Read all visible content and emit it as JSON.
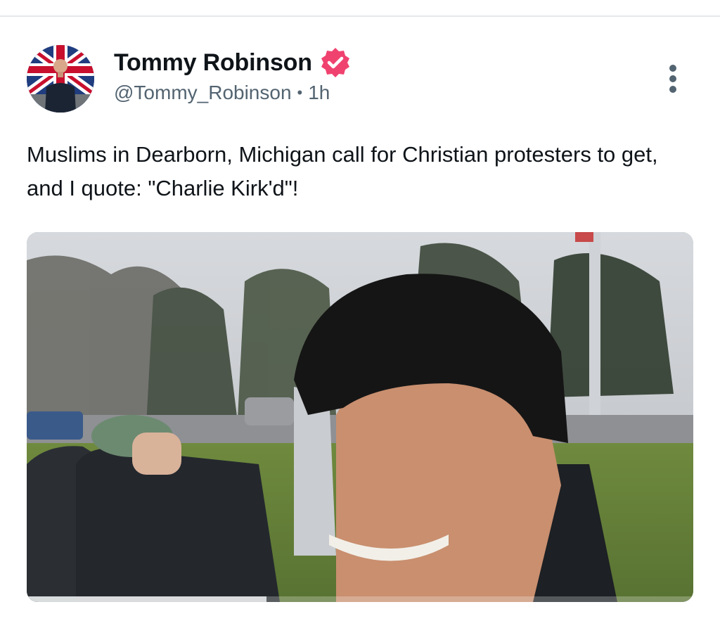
{
  "post": {
    "author": {
      "display_name": "Tommy Robinson",
      "handle": "@Tommy_Robinson",
      "verified": true,
      "verified_color": "#f0426f"
    },
    "separator": "•",
    "time": "1h",
    "text": "Muslims in Dearborn, Michigan call for Christian protesters to get, and I quote: \"Charlie Kirk'd\"!",
    "media": {
      "type": "video",
      "progress": 0.36
    },
    "menu_icon": "more-vertical-icon"
  },
  "colors": {
    "text_primary": "#0f1419",
    "text_secondary": "#536471",
    "divider": "#e6e8eb"
  }
}
